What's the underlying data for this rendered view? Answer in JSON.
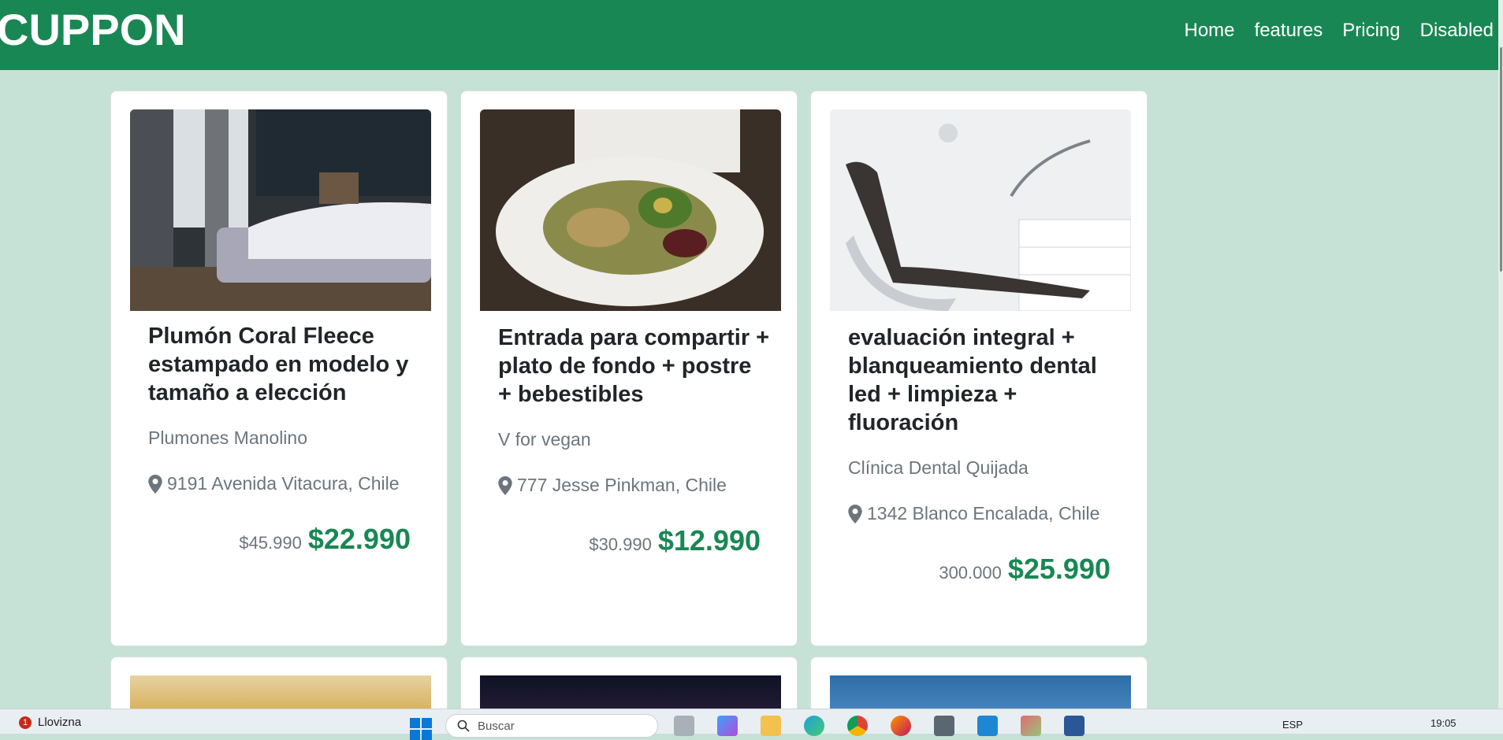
{
  "navbar": {
    "brand": "CUPPON",
    "links": [
      "Home",
      "features",
      "Pricing",
      "Disabled"
    ]
  },
  "cards": [
    {
      "image": "bedroom-bed-photo",
      "title": "Plumón Coral Fleece estampado en modelo y tamaño a elección",
      "vendor": "Plumones Manolino",
      "location": "9191 Avenida Vitacura, Chile",
      "old_price": "$45.990",
      "new_price": "$22.990"
    },
    {
      "image": "salad-plate-photo",
      "title": "Entrada para compartir + plato de fondo + postre + bebestibles",
      "vendor": "V for vegan",
      "location": "777 Jesse Pinkman, Chile",
      "old_price": "$30.990",
      "new_price": "$12.990"
    },
    {
      "image": "dental-clinic-photo",
      "title": "evaluación integral + blanqueamiento dental led + limpieza + fluoración",
      "vendor": "Clínica Dental Quijada",
      "location": "1342 Blanco Encalada, Chile",
      "old_price": "300.000",
      "new_price": "$25.990"
    }
  ],
  "taskbar": {
    "weather_badge": "1",
    "weather_text": "Llovizna",
    "search_placeholder": "Buscar",
    "language": "ESP",
    "time": "19:05"
  },
  "colors": {
    "primary": "#198754",
    "background": "#c6e1d6",
    "muted": "#6c757d"
  }
}
